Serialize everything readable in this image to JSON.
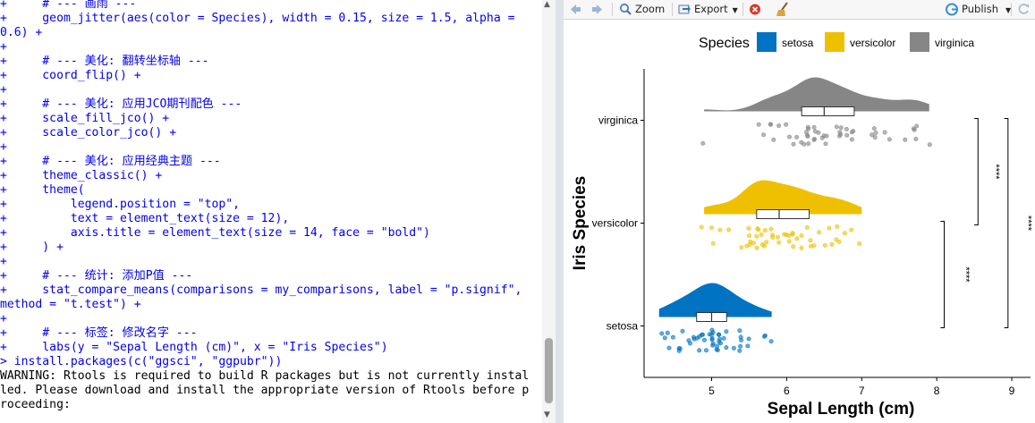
{
  "console": {
    "code_lines": [
      "+     # --- 画雨 ---",
      "+     geom_jitter(aes(color = Species), width = 0.15, size = 1.5, alpha =",
      "0.6) +",
      "+",
      "+     # --- 美化: 翻转坐标轴 ---",
      "+     coord_flip() +",
      "+",
      "+     # --- 美化: 应用JCO期刊配色 ---",
      "+     scale_fill_jco() +",
      "+     scale_color_jco() +",
      "+",
      "+     # --- 美化: 应用经典主题 ---",
      "+     theme_classic() +",
      "+     theme(",
      "+         legend.position = \"top\",",
      "+         text = element_text(size = 12),",
      "+         axis.title = element_text(size = 14, face = \"bold\")",
      "+     ) +",
      "+",
      "+     # --- 统计: 添加P值 ---",
      "+     stat_compare_means(comparisons = my_comparisons, label = \"p.signif\",",
      "method = \"t.test\") +",
      "+",
      "+     # --- 标签: 修改名字 ---",
      "+     labs(y = \"Sepal Length (cm)\", x = \"Iris Species\")",
      "> install.packages(c(\"ggsci\", \"ggpubr\"))"
    ],
    "warning_lines": [
      "WARNING: Rtools is required to build R packages but is not currently instal",
      "led. Please download and install the appropriate version of Rtools before p",
      "roceeding:"
    ]
  },
  "toolbar": {
    "back_icon": "arrow-left-icon",
    "forward_icon": "arrow-right-icon",
    "zoom_label": "Zoom",
    "export_label": "Export",
    "remove_icon": "remove-plot-icon",
    "clear_icon": "broom-icon",
    "publish_label": "Publish",
    "refresh_icon": "refresh-icon"
  },
  "chart_data": {
    "type": "raincloud",
    "orientation": "horizontal",
    "categories": [
      "setosa",
      "versicolor",
      "virginica"
    ],
    "colors": {
      "setosa": "#0073C2",
      "versicolor": "#EFC000",
      "virginica": "#868686"
    },
    "legend": {
      "title": "Species",
      "entries": [
        "setosa",
        "versicolor",
        "virginica"
      ],
      "position": "top"
    },
    "xlabel": "Sepal Length (cm)",
    "ylabel": "Iris Species",
    "xticks": [
      5,
      6,
      7,
      8,
      9
    ],
    "xlim": [
      4.1,
      9.25
    ],
    "boxes": [
      {
        "name": "setosa",
        "q1": 4.8,
        "median": 5.0,
        "q3": 5.2,
        "min": 4.3,
        "max": 5.8
      },
      {
        "name": "versicolor",
        "q1": 5.6,
        "median": 5.9,
        "q3": 6.3,
        "min": 4.9,
        "max": 7.0
      },
      {
        "name": "virginica",
        "q1": 6.2,
        "median": 6.5,
        "q3": 6.9,
        "min": 4.9,
        "max": 7.9
      }
    ],
    "points": {
      "setosa": [
        5.1,
        4.9,
        4.7,
        4.6,
        5.0,
        5.4,
        4.6,
        5.0,
        4.4,
        4.9,
        5.4,
        4.8,
        4.8,
        4.3,
        5.8,
        5.7,
        5.4,
        5.1,
        5.7,
        5.1,
        5.4,
        5.1,
        4.6,
        5.1,
        4.8,
        5.0,
        5.0,
        5.2,
        5.2,
        4.7,
        4.8,
        5.4,
        5.2,
        5.5,
        4.9,
        5.0,
        5.5,
        4.9,
        4.4,
        5.1,
        5.0,
        4.5,
        4.4,
        5.0,
        5.1,
        4.8,
        5.1,
        4.6,
        5.3,
        5.0
      ],
      "versicolor": [
        7.0,
        6.4,
        6.9,
        5.5,
        6.5,
        5.7,
        6.3,
        4.9,
        6.6,
        5.2,
        5.0,
        5.9,
        6.0,
        6.1,
        5.6,
        6.7,
        5.6,
        5.8,
        6.2,
        5.6,
        5.9,
        6.1,
        6.3,
        6.1,
        6.4,
        6.6,
        6.8,
        6.7,
        6.0,
        5.7,
        5.5,
        5.5,
        5.8,
        6.0,
        5.4,
        6.0,
        6.7,
        6.3,
        5.6,
        5.5,
        5.5,
        6.1,
        5.8,
        5.0,
        5.6,
        5.7,
        5.7,
        6.2,
        5.1,
        5.7
      ],
      "virginica": [
        6.3,
        5.8,
        7.1,
        6.3,
        6.5,
        7.6,
        4.9,
        7.3,
        6.7,
        7.2,
        6.5,
        6.4,
        6.8,
        5.7,
        5.8,
        6.4,
        6.5,
        7.7,
        7.7,
        6.0,
        6.9,
        5.6,
        7.7,
        6.3,
        6.7,
        7.2,
        6.2,
        6.1,
        6.4,
        7.2,
        7.4,
        7.9,
        6.4,
        6.3,
        6.1,
        7.7,
        6.3,
        6.4,
        6.0,
        6.9,
        6.7,
        6.9,
        5.8,
        6.8,
        6.7,
        6.7,
        6.3,
        6.5,
        6.2,
        5.9
      ]
    },
    "comparisons": [
      {
        "groups": [
          "setosa",
          "versicolor"
        ],
        "label": "****"
      },
      {
        "groups": [
          "versicolor",
          "virginica"
        ],
        "label": "****"
      },
      {
        "groups": [
          "setosa",
          "virginica"
        ],
        "label": "****"
      }
    ]
  }
}
